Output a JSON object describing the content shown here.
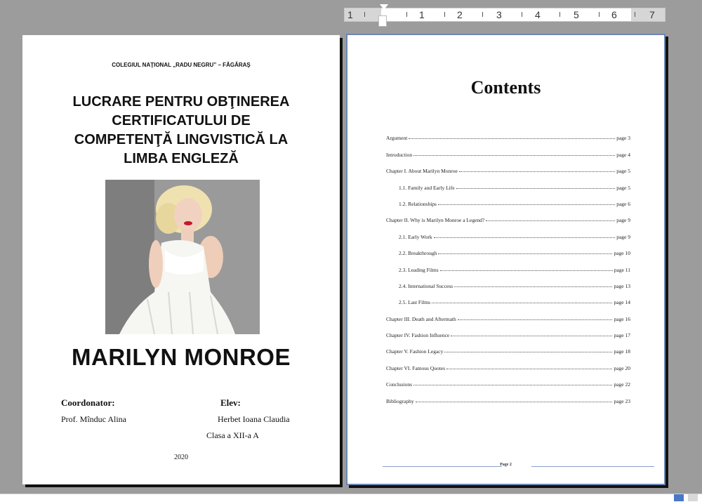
{
  "ruler": {
    "labels": [
      "1",
      "1",
      "2",
      "3",
      "4",
      "5",
      "6",
      "7"
    ]
  },
  "cover": {
    "school": "COLEGIUL NAŢIONAL „RADU NEGRU” – FĂGĂRAŞ",
    "title_lines": [
      "LUCRARE PENTRU OBŢINEREA",
      "CERTIFICATULUI DE",
      "COMPETENŢĂ LINGVISTICĂ LA",
      "LIMBA ENGLEZĂ"
    ],
    "name": "MARILYN MONROE",
    "coordinator_label": "Coordonator:",
    "coordinator_name": "Prof. Mînduc Alina",
    "student_label": "Elev:",
    "student_name": "Herbet Ioana Claudia",
    "student_class": "Clasa a XII-a  A",
    "year": "2020"
  },
  "toc": {
    "title": "Contents",
    "entries": [
      {
        "text": "Argument",
        "page": "page 3",
        "indent": 0
      },
      {
        "text": "Introduction",
        "page": "page 4",
        "indent": 0
      },
      {
        "text": "Chapter I. About Marilyn Monroe",
        "page": "page 5",
        "indent": 0
      },
      {
        "text": "1.1.  Family and Early Life",
        "page": "page 5",
        "indent": 1
      },
      {
        "text": "1.2.  Relationships",
        "page": "page 6",
        "indent": 1
      },
      {
        "text": "Chapter II. Why is Marilyn Monroe a Legend?",
        "page": "page 9",
        "indent": 0
      },
      {
        "text": "2.1.  Early Work",
        "page": "page 9",
        "indent": 1
      },
      {
        "text": "2.2.  Breakthrough",
        "page": "page 10",
        "indent": 1
      },
      {
        "text": "2.3.  Leading Films",
        "page": "page 11",
        "indent": 1
      },
      {
        "text": "2.4.  International Success",
        "page": "page 13",
        "indent": 1
      },
      {
        "text": "2.5.  Last Films",
        "page": "page 14",
        "indent": 1
      },
      {
        "text": "Chapter III. Death and Aftermath",
        "page": "page 16",
        "indent": 0
      },
      {
        "text": "Chapter IV. Fashion Influence",
        "page": "page 17",
        "indent": 0
      },
      {
        "text": "Chapter V. Fashion Legacy",
        "page": "page 18",
        "indent": 0
      },
      {
        "text": "Chapter VI. Famous Quotes",
        "page": "page 20",
        "indent": 0
      },
      {
        "text": "Conclusions",
        "page": "page 22",
        "indent": 0
      },
      {
        "text": "Bibliography",
        "page": "page 23",
        "indent": 0
      }
    ],
    "footer": "Page 2"
  },
  "colors": {
    "workspace": "#9c9c9c",
    "page_border": "#6d86b6",
    "footer_line": "#8aa0c8"
  }
}
